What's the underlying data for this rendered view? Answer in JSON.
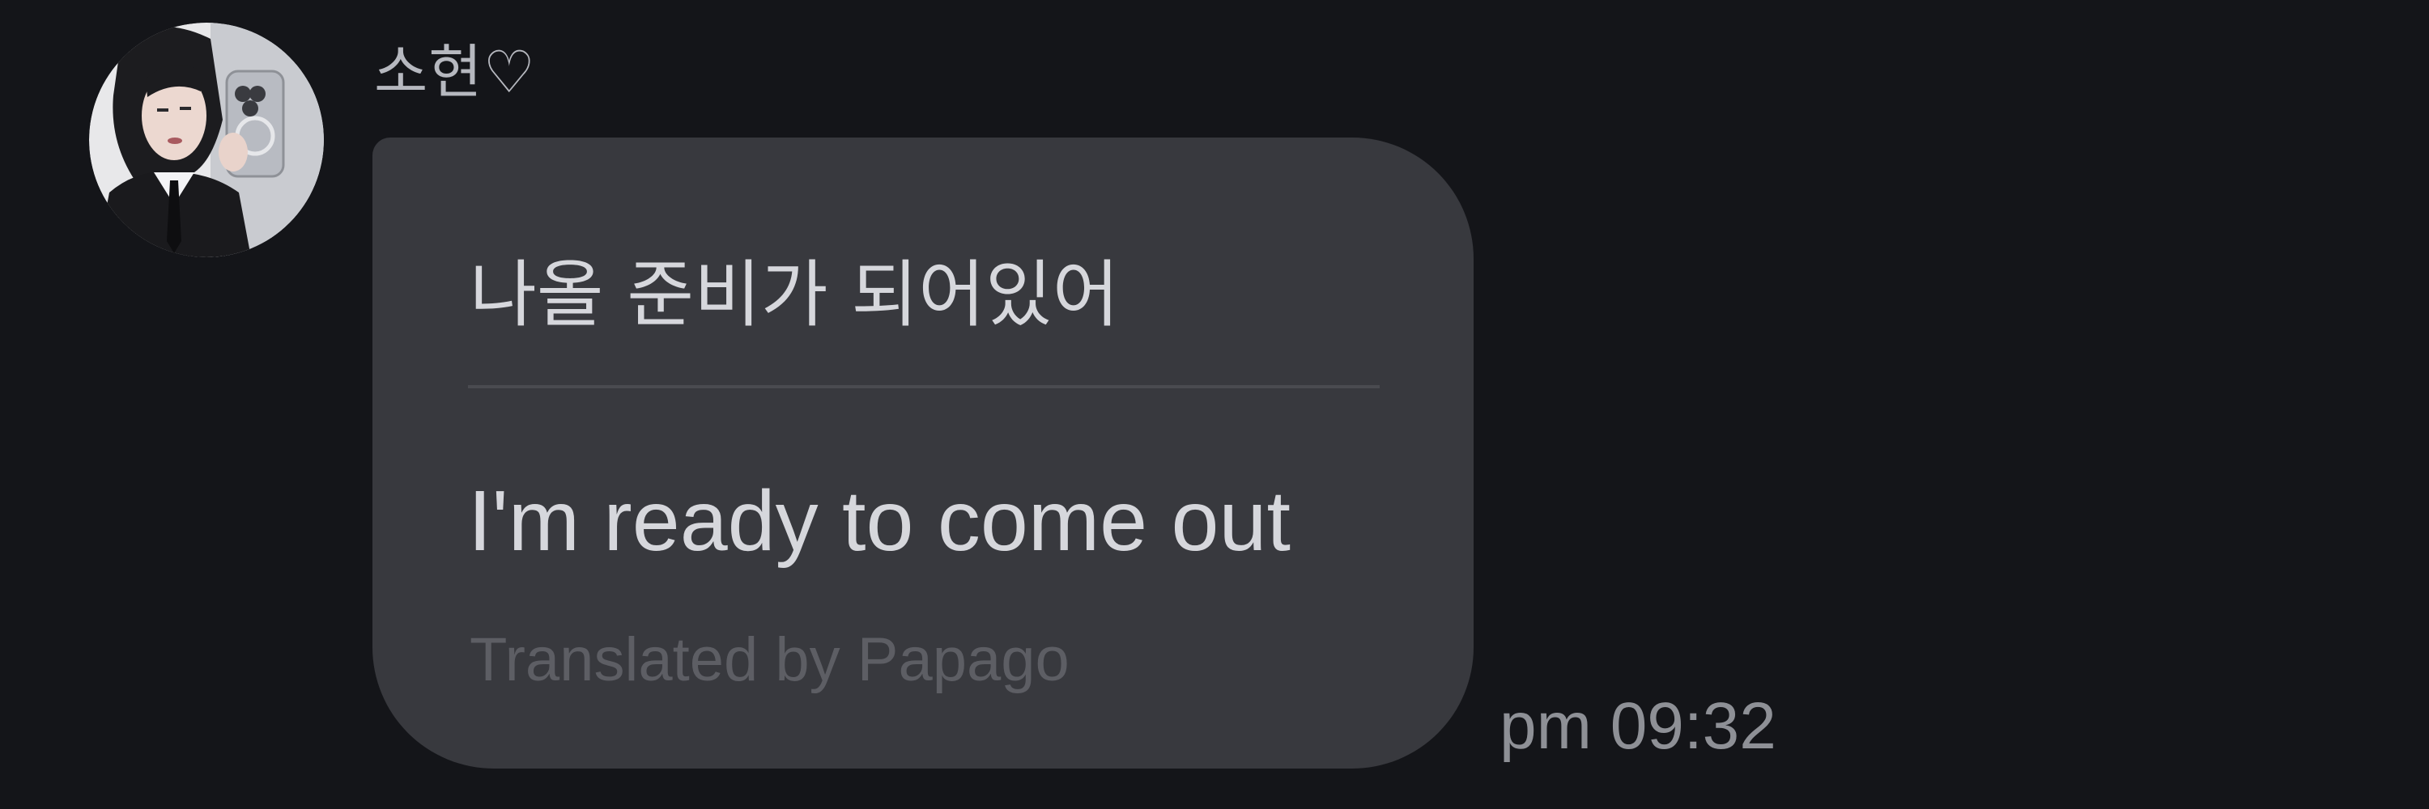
{
  "message": {
    "sender": {
      "name": "소현♡",
      "avatar_icon": "profile-photo"
    },
    "original_text": "나올 준비가 되어있어",
    "translated_text": "I'm ready to come out",
    "translation_credit": "Translated by Papago",
    "timestamp": "pm 09:32"
  },
  "colors": {
    "background": "#141519",
    "bubble": "#38393e",
    "primary_text": "#d6d7dc",
    "secondary_text": "#8e9096",
    "muted_text": "#5d5e64"
  }
}
